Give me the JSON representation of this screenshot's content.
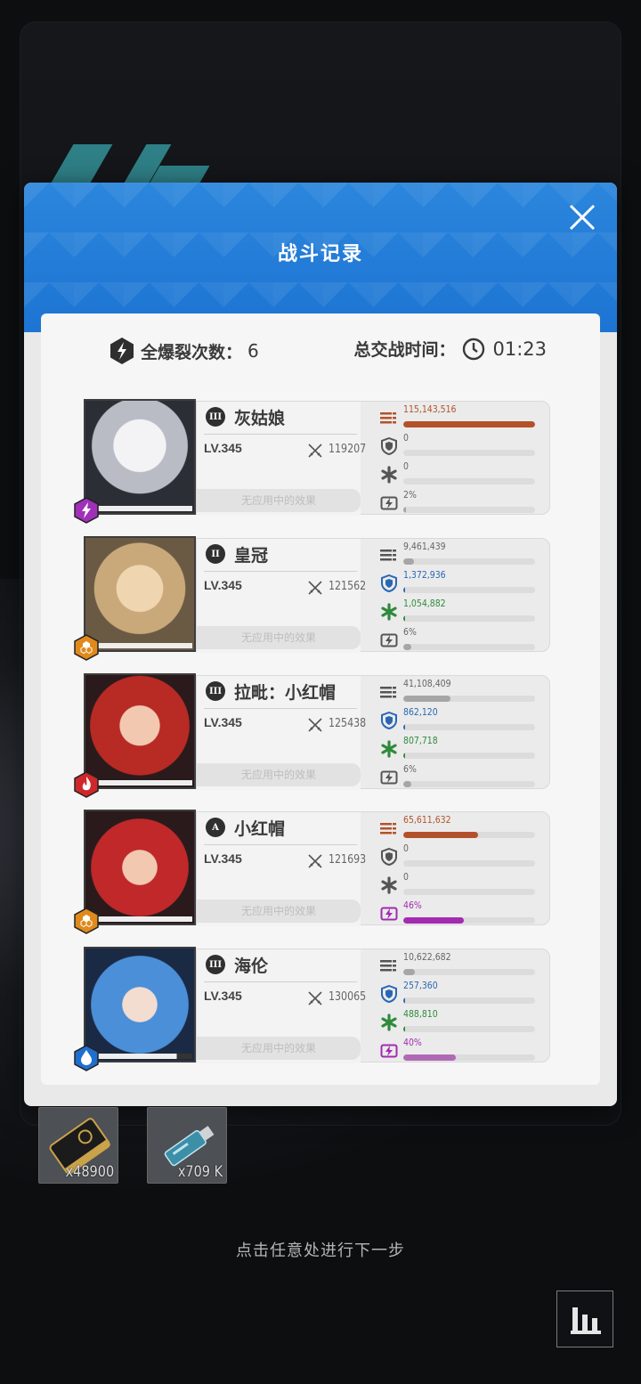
{
  "modal": {
    "title": "战斗记录",
    "full_burst_label": "全爆裂次数：",
    "full_burst_count": "6",
    "battle_time_label": "总交战时间：",
    "battle_time": "01:23"
  },
  "characters": [
    {
      "burst": "III",
      "name": "灰姑娘",
      "level": "LV.345",
      "power": "119207",
      "effect": "无应用中的效果",
      "element": "electric",
      "element_color": "#a030b8",
      "hp_fraction": 1.0,
      "damage": "115,143,516",
      "damage_frac": 1.0,
      "shield": "0",
      "shield_frac": 0,
      "heal": "0",
      "heal_frac": 0,
      "burst_gauge": "2%",
      "burst_frac": 0.02
    },
    {
      "burst": "II",
      "name": "皇冠",
      "level": "LV.345",
      "power": "121562",
      "effect": "无应用中的效果",
      "element": "iron",
      "element_color": "#e08a1c",
      "hp_fraction": 1.0,
      "damage": "9,461,439",
      "damage_frac": 0.08,
      "shield": "1,372,936",
      "shield_frac": 0.01,
      "heal": "1,054,882",
      "heal_frac": 0.01,
      "burst_gauge": "6%",
      "burst_frac": 0.06
    },
    {
      "burst": "III",
      "name": "拉毗：小红帽",
      "level": "LV.345",
      "power": "125438",
      "effect": "无应用中的效果",
      "element": "fire",
      "element_color": "#d0282a",
      "hp_fraction": 1.0,
      "damage": "41,108,409",
      "damage_frac": 0.36,
      "shield": "862,120",
      "shield_frac": 0.01,
      "heal": "807,718",
      "heal_frac": 0.01,
      "burst_gauge": "6%",
      "burst_frac": 0.06
    },
    {
      "burst": "A",
      "name": "小红帽",
      "level": "LV.345",
      "power": "121693",
      "effect": "无应用中的效果",
      "element": "iron",
      "element_color": "#e08a1c",
      "hp_fraction": 1.0,
      "damage": "65,611,632",
      "damage_frac": 0.57,
      "shield": "0",
      "shield_frac": 0,
      "heal": "0",
      "heal_frac": 0,
      "burst_gauge": "46%",
      "burst_frac": 0.46
    },
    {
      "burst": "III",
      "name": "海伦",
      "level": "LV.345",
      "power": "130065",
      "effect": "无应用中的效果",
      "element": "water",
      "element_color": "#1f6fd0",
      "hp_fraction": 0.85,
      "damage": "10,622,682",
      "damage_frac": 0.09,
      "shield": "257,360",
      "shield_frac": 0.01,
      "heal": "488,810",
      "heal_frac": 0.01,
      "burst_gauge": "40%",
      "burst_frac": 0.4
    }
  ],
  "rewards": [
    {
      "icon": "credit-card-icon",
      "quantity": "x48900"
    },
    {
      "icon": "usb-drive-icon",
      "quantity": "x709 K"
    }
  ],
  "hint": "点击任意处进行下一步",
  "colors": {
    "header_blue": "#1d74d3",
    "damage": "#b3522a",
    "shield": "#2a67b3",
    "heal": "#2f8a3c",
    "burst_active": "#a32bb0",
    "burst_idle": "#b06ab5",
    "bar_idle": "#a6a6a6"
  }
}
